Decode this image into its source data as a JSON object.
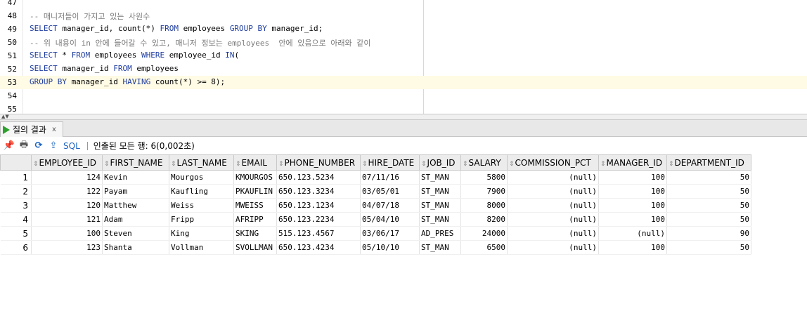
{
  "editor": {
    "lines": [
      {
        "num": "47",
        "segments": []
      },
      {
        "num": "48",
        "segments": [
          {
            "t": "-- 매니저들이 가지고 있는 사원수",
            "c": "cm"
          }
        ]
      },
      {
        "num": "49",
        "segments": [
          {
            "t": "SELECT",
            "c": "kw"
          },
          {
            "t": " manager_id, count(*) ",
            "c": ""
          },
          {
            "t": "FROM",
            "c": "kw"
          },
          {
            "t": " employees ",
            "c": ""
          },
          {
            "t": "GROUP BY",
            "c": "kw"
          },
          {
            "t": " manager_id;",
            "c": ""
          }
        ]
      },
      {
        "num": "50",
        "segments": [
          {
            "t": "-- 위 내용이 in 안에 들어갈 수 있고, 매니저 정보는 employees  안에 있음으로 아래와 같이",
            "c": "cm"
          }
        ]
      },
      {
        "num": "51",
        "segments": [
          {
            "t": "SELECT",
            "c": "kw"
          },
          {
            "t": " * ",
            "c": ""
          },
          {
            "t": "FROM",
            "c": "kw"
          },
          {
            "t": " employees ",
            "c": ""
          },
          {
            "t": "WHERE",
            "c": "kw"
          },
          {
            "t": " employee_id ",
            "c": ""
          },
          {
            "t": "IN",
            "c": "kw"
          },
          {
            "t": "(",
            "c": ""
          }
        ]
      },
      {
        "num": "52",
        "segments": [
          {
            "t": "SELECT",
            "c": "kw"
          },
          {
            "t": " manager_id ",
            "c": ""
          },
          {
            "t": "FROM",
            "c": "kw"
          },
          {
            "t": " employees",
            "c": ""
          }
        ]
      },
      {
        "num": "53",
        "segments": [
          {
            "t": "GROUP BY",
            "c": "kw"
          },
          {
            "t": " manager_id ",
            "c": ""
          },
          {
            "t": "HAVING",
            "c": "kw"
          },
          {
            "t": " count(*) >= 8);",
            "c": ""
          }
        ],
        "current": true
      },
      {
        "num": "54",
        "segments": []
      },
      {
        "num": "55",
        "segments": []
      }
    ]
  },
  "results_tab": {
    "label": "질의 결과",
    "close": "x"
  },
  "toolbar": {
    "sql_label": "SQL",
    "separator": "|",
    "status": "인출된 모든 행: 6(0,002초)"
  },
  "grid": {
    "columns": [
      "EMPLOYEE_ID",
      "FIRST_NAME",
      "LAST_NAME",
      "EMAIL",
      "PHONE_NUMBER",
      "HIRE_DATE",
      "JOB_ID",
      "SALARY",
      "COMMISSION_PCT",
      "MANAGER_ID",
      "DEPARTMENT_ID"
    ],
    "rows": [
      [
        "1",
        "124",
        "Kevin",
        "Mourgos",
        "KMOURGOS",
        "650.123.5234",
        "07/11/16",
        "ST_MAN",
        "5800",
        "(null)",
        "100",
        "50"
      ],
      [
        "2",
        "122",
        "Payam",
        "Kaufling",
        "PKAUFLIN",
        "650.123.3234",
        "03/05/01",
        "ST_MAN",
        "7900",
        "(null)",
        "100",
        "50"
      ],
      [
        "3",
        "120",
        "Matthew",
        "Weiss",
        "MWEISS",
        "650.123.1234",
        "04/07/18",
        "ST_MAN",
        "8000",
        "(null)",
        "100",
        "50"
      ],
      [
        "4",
        "121",
        "Adam",
        "Fripp",
        "AFRIPP",
        "650.123.2234",
        "05/04/10",
        "ST_MAN",
        "8200",
        "(null)",
        "100",
        "50"
      ],
      [
        "5",
        "100",
        "Steven",
        "King",
        "SKING",
        "515.123.4567",
        "03/06/17",
        "AD_PRES",
        "24000",
        "(null)",
        "(null)",
        "90"
      ],
      [
        "6",
        "123",
        "Shanta",
        "Vollman",
        "SVOLLMAN",
        "650.123.4234",
        "05/10/10",
        "ST_MAN",
        "6500",
        "(null)",
        "100",
        "50"
      ]
    ]
  }
}
